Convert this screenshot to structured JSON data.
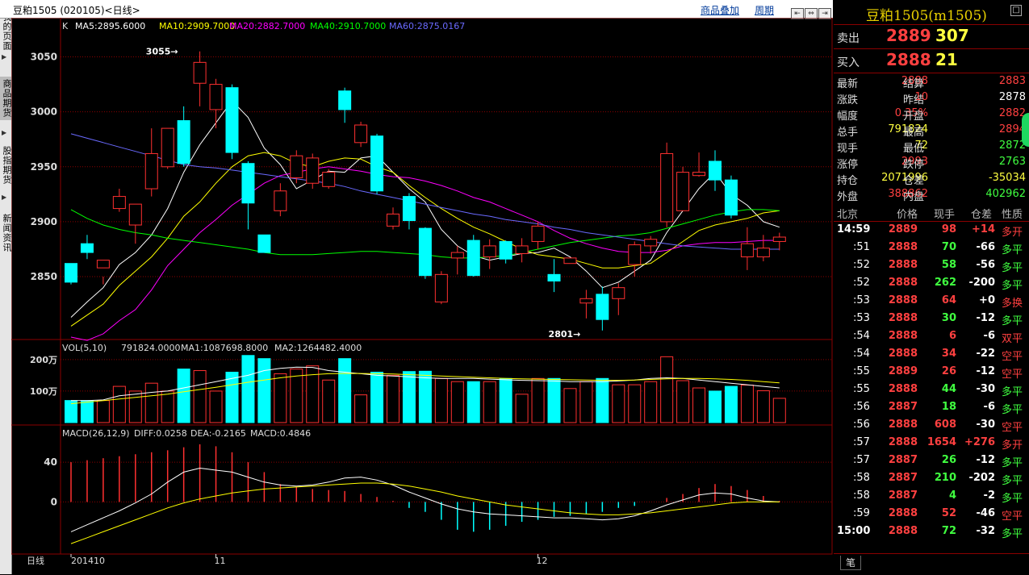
{
  "title_bar": {
    "text": "豆粕1505 (020105)<日线>",
    "link_overlay": "商品叠加",
    "link_period": "周期"
  },
  "sidebar": {
    "tabs": [
      "我的页面",
      "商品期货",
      "股指期货",
      "新闻资讯"
    ],
    "active_index": 1
  },
  "colors": {
    "up": "#ff3030",
    "down": "#00ffff",
    "ma5": "#ffffff",
    "ma10": "#ffff00",
    "ma20": "#ff00ff",
    "ma40": "#00ff00",
    "ma60": "#6a6aff",
    "grid": "#8b0000"
  },
  "chart_data": {
    "type": "candlestick",
    "price_panel": {
      "label": "K",
      "legend": [
        {
          "name": "MA5",
          "text": "MA5:2895.6000"
        },
        {
          "name": "MA10",
          "text": "MA10:2909.7000"
        },
        {
          "name": "MA20",
          "text": "MA20:2882.7000"
        },
        {
          "name": "MA40",
          "text": "MA40:2910.7000"
        },
        {
          "name": "MA60",
          "text": "MA60:2875.0167"
        }
      ],
      "y_ticks": [
        2850,
        2900,
        2950,
        3000,
        3050
      ],
      "ylim": [
        2795,
        3068
      ],
      "annotations": [
        {
          "text": "3055",
          "index": 7,
          "value": 3055
        },
        {
          "text": "2801",
          "index": 32,
          "value": 2801
        }
      ],
      "candles": [
        [
          2862,
          2845,
          2852,
          2843
        ],
        [
          2880,
          2872,
          2888,
          2866
        ],
        [
          2858,
          2865,
          2850,
          2843
        ],
        [
          2912,
          2923,
          2930,
          2909
        ],
        [
          2897,
          2916,
          2899,
          2880
        ],
        [
          2930,
          2962,
          2985,
          2923
        ],
        [
          2950,
          2985,
          2985,
          2948
        ],
        [
          2992,
          2953,
          3005,
          2950
        ],
        [
          3026,
          3045,
          3055,
          3005
        ],
        [
          3002,
          3025,
          3030,
          2985
        ],
        [
          3022,
          2963,
          3025,
          2957
        ],
        [
          2953,
          2917,
          2955,
          2893
        ],
        [
          2888,
          2872,
          2880,
          2872
        ],
        [
          2910,
          2928,
          2935,
          2905
        ],
        [
          2940,
          2960,
          2965,
          2935
        ],
        [
          2935,
          2958,
          2962,
          2930
        ],
        [
          2932,
          2945,
          2948,
          2930
        ],
        [
          3019,
          3002,
          3022,
          2990
        ],
        [
          2972,
          2988,
          2991,
          2968
        ],
        [
          2978,
          2928,
          2980,
          2925
        ],
        [
          2896,
          2907,
          2913,
          2893
        ],
        [
          2923,
          2901,
          2926,
          2893
        ],
        [
          2894,
          2851,
          2895,
          2848
        ],
        [
          2827,
          2852,
          2855,
          2825
        ],
        [
          2867,
          2872,
          2878,
          2852
        ],
        [
          2883,
          2851,
          2888,
          2850
        ],
        [
          2868,
          2878,
          2884,
          2857
        ],
        [
          2882,
          2866,
          2883,
          2862
        ],
        [
          2871,
          2878,
          2885,
          2863
        ],
        [
          2882,
          2896,
          2900,
          2875
        ],
        [
          2852,
          2846,
          2866,
          2836
        ],
        [
          2862,
          2867,
          2867,
          2864
        ],
        [
          2826,
          2830,
          2838,
          2812
        ],
        [
          2834,
          2811,
          2841,
          2801
        ],
        [
          2830,
          2840,
          2844,
          2815
        ],
        [
          2861,
          2879,
          2882,
          2850
        ],
        [
          2878,
          2884,
          2887,
          2871
        ],
        [
          2900,
          2962,
          2972,
          2895
        ],
        [
          2910,
          2945,
          2950,
          2927
        ],
        [
          2942,
          2945,
          2963,
          2941
        ],
        [
          2955,
          2938,
          2965,
          2928
        ],
        [
          2938,
          2906,
          2942,
          2903
        ],
        [
          2868,
          2880,
          2895,
          2856
        ],
        [
          2868,
          2876,
          2888,
          2864
        ],
        [
          2882,
          2886,
          2890,
          2874
        ]
      ],
      "ma": {
        "MA5": [
          2813,
          2827,
          2840,
          2861,
          2872,
          2888,
          2912,
          2945,
          2970,
          2990,
          3010,
          2995,
          2967,
          2952,
          2930,
          2938,
          2946,
          2945,
          2958,
          2960,
          2945,
          2930,
          2918,
          2893,
          2878,
          2869,
          2865,
          2868,
          2871,
          2872,
          2876,
          2868,
          2855,
          2840,
          2845,
          2855,
          2865,
          2890,
          2910,
          2930,
          2945,
          2925,
          2915,
          2900,
          2895
        ],
        "MA10": [
          2805,
          2815,
          2825,
          2842,
          2855,
          2868,
          2885,
          2905,
          2918,
          2935,
          2950,
          2960,
          2963,
          2960,
          2953,
          2950,
          2955,
          2958,
          2957,
          2950,
          2945,
          2933,
          2922,
          2912,
          2903,
          2895,
          2889,
          2882,
          2875,
          2870,
          2868,
          2866,
          2862,
          2858,
          2858,
          2860,
          2862,
          2872,
          2882,
          2892,
          2897,
          2900,
          2903,
          2908,
          2910
        ],
        "MA20": [
          2795,
          2792,
          2798,
          2810,
          2820,
          2838,
          2860,
          2875,
          2890,
          2902,
          2915,
          2925,
          2935,
          2942,
          2945,
          2948,
          2950,
          2948,
          2946,
          2943,
          2941,
          2940,
          2937,
          2933,
          2928,
          2922,
          2918,
          2912,
          2906,
          2900,
          2892,
          2885,
          2880,
          2876,
          2873,
          2872,
          2872,
          2874,
          2878,
          2880,
          2881,
          2881,
          2882,
          2883,
          2883
        ],
        "MA40": [
          2911,
          2903,
          2897,
          2893,
          2890,
          2888,
          2885,
          2883,
          2881,
          2879,
          2877,
          2875,
          2872,
          2870,
          2870,
          2870,
          2871,
          2872,
          2873,
          2873,
          2872,
          2871,
          2870,
          2868,
          2867,
          2867,
          2868,
          2869,
          2872,
          2875,
          2878,
          2881,
          2883,
          2885,
          2887,
          2888,
          2890,
          2894,
          2898,
          2902,
          2906,
          2909,
          2911,
          2911,
          2910
        ],
        "MA60": [
          2980,
          2976,
          2972,
          2968,
          2964,
          2960,
          2956,
          2952,
          2950,
          2949,
          2947,
          2945,
          2943,
          2941,
          2939,
          2937,
          2935,
          2932,
          2928,
          2925,
          2922,
          2919,
          2916,
          2913,
          2910,
          2907,
          2905,
          2902,
          2900,
          2898,
          2895,
          2893,
          2890,
          2888,
          2886,
          2884,
          2882,
          2880,
          2878,
          2877,
          2876,
          2875,
          2875,
          2875,
          2875
        ]
      }
    },
    "volume_panel": {
      "label": "VOL(5,10)",
      "legend": [
        {
          "name": "VOL",
          "text": "791824.0000"
        },
        {
          "name": "MA1",
          "text": "MA1:1087698.8000"
        },
        {
          "name": "MA2",
          "text": "MA2:1264482.4000"
        }
      ],
      "y_ticks": [
        {
          "label": "100万",
          "value": 1000000
        },
        {
          "label": "200万",
          "value": 2000000
        }
      ],
      "ylim": [
        0,
        2150000
      ],
      "values": [
        700000,
        700000,
        700000,
        1150000,
        1000000,
        1250000,
        1000000,
        1700000,
        1650000,
        1000000,
        1600000,
        2130000,
        2030000,
        1550000,
        1700000,
        1800000,
        1350000,
        2030000,
        880000,
        1600000,
        1500000,
        1620000,
        1630000,
        1400000,
        1300000,
        1300000,
        1300000,
        1400000,
        900000,
        1400000,
        1400000,
        1080000,
        1300000,
        1400000,
        1200000,
        1200000,
        1300000,
        2090000,
        1330000,
        1100000,
        1000000,
        1150000,
        1190000,
        1010000,
        770000
      ],
      "ma1": [
        700000,
        700000,
        720000,
        850000,
        900000,
        960000,
        1000000,
        1100000,
        1200000,
        1300000,
        1400000,
        1500000,
        1650000,
        1720000,
        1760000,
        1750000,
        1650000,
        1600000,
        1550000,
        1500000,
        1480000,
        1450000,
        1420000,
        1400000,
        1400000,
        1400000,
        1380000,
        1360000,
        1340000,
        1330000,
        1320000,
        1300000,
        1300000,
        1300000,
        1320000,
        1350000,
        1400000,
        1420000,
        1400000,
        1350000,
        1300000,
        1250000,
        1200000,
        1150000,
        1100000
      ],
      "ma2": [
        600000,
        650000,
        700000,
        750000,
        800000,
        850000,
        900000,
        980000,
        1050000,
        1120000,
        1200000,
        1280000,
        1350000,
        1420000,
        1480000,
        1520000,
        1550000,
        1560000,
        1560000,
        1550000,
        1540000,
        1520000,
        1500000,
        1480000,
        1460000,
        1440000,
        1420000,
        1400000,
        1390000,
        1380000,
        1370000,
        1360000,
        1350000,
        1340000,
        1340000,
        1350000,
        1370000,
        1390000,
        1400000,
        1400000,
        1390000,
        1370000,
        1340000,
        1300000,
        1260000
      ]
    },
    "macd_panel": {
      "label": "MACD(26,12,9)",
      "legend": [
        {
          "name": "DIFF",
          "text": "DIFF:0.0258"
        },
        {
          "name": "DEA",
          "text": "DEA:-0.2165"
        },
        {
          "name": "MACD",
          "text": "MACD:0.4846"
        }
      ],
      "y_ticks": [
        0,
        40
      ],
      "ylim": [
        -50,
        62
      ],
      "hist": [
        40,
        42,
        44,
        46,
        48,
        50,
        52,
        55,
        58,
        56,
        50,
        40,
        30,
        18,
        15,
        13,
        12,
        11,
        8,
        5,
        1,
        -6,
        -10,
        -18,
        -28,
        -30,
        -28,
        -24,
        -20,
        -18,
        -15,
        -14,
        -12,
        -10,
        -6,
        -4,
        0,
        4,
        8,
        14,
        18,
        16,
        12,
        6,
        1
      ],
      "diff": [
        -30,
        -23,
        -16,
        -9,
        -1,
        8,
        20,
        30,
        34,
        32,
        30,
        25,
        20,
        17,
        16,
        17,
        20,
        24,
        25,
        22,
        17,
        10,
        4,
        -2,
        -7,
        -10,
        -12,
        -13,
        -14,
        -15,
        -16,
        -16,
        -17,
        -18,
        -17,
        -14,
        -9,
        -3,
        2,
        7,
        9,
        8,
        4,
        1,
        0
      ],
      "dea": [
        -42,
        -36,
        -30,
        -24,
        -18,
        -12,
        -6,
        -1,
        3,
        6,
        9,
        11,
        13,
        14,
        15,
        16,
        17,
        18,
        19,
        19,
        18,
        16,
        13,
        10,
        6,
        3,
        0,
        -3,
        -5,
        -7,
        -9,
        -11,
        -12,
        -13,
        -13,
        -12,
        -11,
        -9,
        -7,
        -5,
        -3,
        -1,
        0,
        0,
        0
      ]
    },
    "x_axis": {
      "period_label": "日线",
      "ticks": [
        {
          "text": "201410",
          "index": 0
        },
        {
          "text": "11",
          "index": 9
        },
        {
          "text": "12",
          "index": 29
        }
      ]
    }
  },
  "quote_panel": {
    "title": "豆粕1505(m1505)",
    "sell": {
      "label": "卖出",
      "price": "2889",
      "vol": "307"
    },
    "buy": {
      "label": "买入",
      "price": "2888",
      "vol": "21"
    },
    "rows": [
      {
        "l1": "最新",
        "v1": "2888",
        "c1": "#ff4040",
        "l2": "结算",
        "v2": "2883",
        "c2": "#ff4040"
      },
      {
        "l1": "涨跌",
        "v1": "10",
        "c1": "#ff4040",
        "l2": "昨结",
        "v2": "2878",
        "c2": "#ffffff"
      },
      {
        "l1": "幅度",
        "v1": "0.35%",
        "c1": "#ff4040",
        "l2": "开盘",
        "v2": "2882",
        "c2": "#ff4040"
      },
      {
        "l1": "总手",
        "v1": "791824",
        "c1": "#ffff40",
        "l2": "最高",
        "v2": "2894",
        "c2": "#ff4040"
      },
      {
        "l1": "现手",
        "v1": "72",
        "c1": "#ffff40",
        "l2": "最低",
        "v2": "2872",
        "c2": "#40ff40"
      },
      {
        "l1": "涨停",
        "v1": "2993",
        "c1": "#ff4040",
        "l2": "跌停",
        "v2": "2763",
        "c2": "#40ff40"
      },
      {
        "l1": "持仓",
        "v1": "2071996",
        "c1": "#ffff40",
        "l2": "仓差",
        "v2": "-35034",
        "c2": "#ffff40"
      },
      {
        "l1": "外盘",
        "v1": "388862",
        "c1": "#ff4040",
        "l2": "内盘",
        "v2": "402962",
        "c2": "#40ff40"
      }
    ],
    "tick_header": [
      "北京",
      "价格",
      "现手",
      "仓差",
      "性质"
    ],
    "ticks": [
      {
        "t": "14:59",
        "p": "2889",
        "v": "98",
        "d": "+14",
        "n": "多开",
        "vc": "#ff4040",
        "dc": "#ff4040",
        "nc": "#ff4040"
      },
      {
        "t": ":51",
        "p": "2888",
        "v": "70",
        "d": "-66",
        "n": "多平",
        "vc": "#40ff40",
        "dc": "#ffffff",
        "nc": "#40ff40"
      },
      {
        "t": ":52",
        "p": "2888",
        "v": "58",
        "d": "-56",
        "n": "多平",
        "vc": "#40ff40",
        "dc": "#ffffff",
        "nc": "#40ff40"
      },
      {
        "t": ":52",
        "p": "2888",
        "v": "262",
        "d": "-200",
        "n": "多平",
        "vc": "#40ff40",
        "dc": "#ffffff",
        "nc": "#40ff40"
      },
      {
        "t": ":53",
        "p": "2888",
        "v": "64",
        "d": "+0",
        "n": "多换",
        "vc": "#ff4040",
        "dc": "#ffffff",
        "nc": "#ff4040"
      },
      {
        "t": ":53",
        "p": "2888",
        "v": "30",
        "d": "-12",
        "n": "多平",
        "vc": "#40ff40",
        "dc": "#ffffff",
        "nc": "#40ff40"
      },
      {
        "t": ":54",
        "p": "2888",
        "v": "6",
        "d": "-6",
        "n": "双平",
        "vc": "#ff4040",
        "dc": "#ffffff",
        "nc": "#ff4040"
      },
      {
        "t": ":54",
        "p": "2888",
        "v": "34",
        "d": "-22",
        "n": "空平",
        "vc": "#ff4040",
        "dc": "#ffffff",
        "nc": "#ff4040"
      },
      {
        "t": ":55",
        "p": "2889",
        "v": "26",
        "d": "-12",
        "n": "空平",
        "vc": "#ff4040",
        "dc": "#ffffff",
        "nc": "#ff4040"
      },
      {
        "t": ":55",
        "p": "2888",
        "v": "44",
        "d": "-30",
        "n": "多平",
        "vc": "#40ff40",
        "dc": "#ffffff",
        "nc": "#40ff40"
      },
      {
        "t": ":56",
        "p": "2887",
        "v": "18",
        "d": "-6",
        "n": "多平",
        "vc": "#40ff40",
        "dc": "#ffffff",
        "nc": "#40ff40"
      },
      {
        "t": ":56",
        "p": "2888",
        "v": "608",
        "d": "-30",
        "n": "空平",
        "vc": "#ff4040",
        "dc": "#ffffff",
        "nc": "#ff4040"
      },
      {
        "t": ":57",
        "p": "2888",
        "v": "1654",
        "d": "+276",
        "n": "多开",
        "vc": "#ff4040",
        "dc": "#ff4040",
        "nc": "#ff4040"
      },
      {
        "t": ":57",
        "p": "2887",
        "v": "26",
        "d": "-12",
        "n": "多平",
        "vc": "#40ff40",
        "dc": "#ffffff",
        "nc": "#40ff40"
      },
      {
        "t": ":58",
        "p": "2887",
        "v": "210",
        "d": "-202",
        "n": "多平",
        "vc": "#40ff40",
        "dc": "#ffffff",
        "nc": "#40ff40"
      },
      {
        "t": ":58",
        "p": "2887",
        "v": "4",
        "d": "-2",
        "n": "多平",
        "vc": "#40ff40",
        "dc": "#ffffff",
        "nc": "#40ff40"
      },
      {
        "t": ":59",
        "p": "2888",
        "v": "52",
        "d": "-46",
        "n": "空平",
        "vc": "#ff4040",
        "dc": "#ffffff",
        "nc": "#ff4040"
      },
      {
        "t": "15:00",
        "p": "2888",
        "v": "72",
        "d": "-32",
        "n": "多平",
        "vc": "#40ff40",
        "dc": "#ffffff",
        "nc": "#40ff40"
      }
    ],
    "footer_tab": "笔"
  }
}
